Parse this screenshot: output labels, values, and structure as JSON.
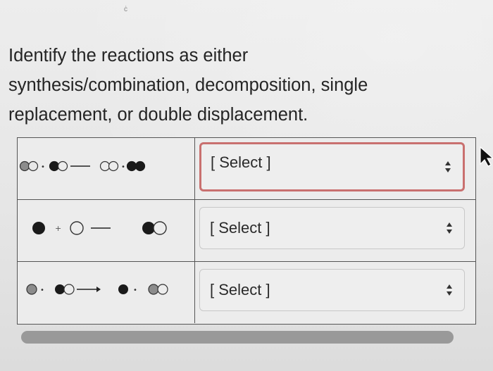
{
  "question": {
    "line1": "Identify the reactions as either",
    "line2": "synthesis/combination, decomposition, single",
    "line3": "replacement, or double displacement."
  },
  "rows": [
    {
      "reaction_icon": "double-displacement-reaction-diagram",
      "select": {
        "value": "[ Select ]",
        "focused": true
      }
    },
    {
      "reaction_icon": "synthesis-reaction-diagram",
      "select": {
        "value": "[ Select ]",
        "focused": false
      }
    },
    {
      "reaction_icon": "single-replacement-reaction-diagram",
      "select": {
        "value": "[ Select ]",
        "focused": false
      }
    }
  ],
  "colors": {
    "focus_border": "#c9706f",
    "black_atom": "#1a1a1a",
    "grey_atom": "#8c8c8c"
  }
}
